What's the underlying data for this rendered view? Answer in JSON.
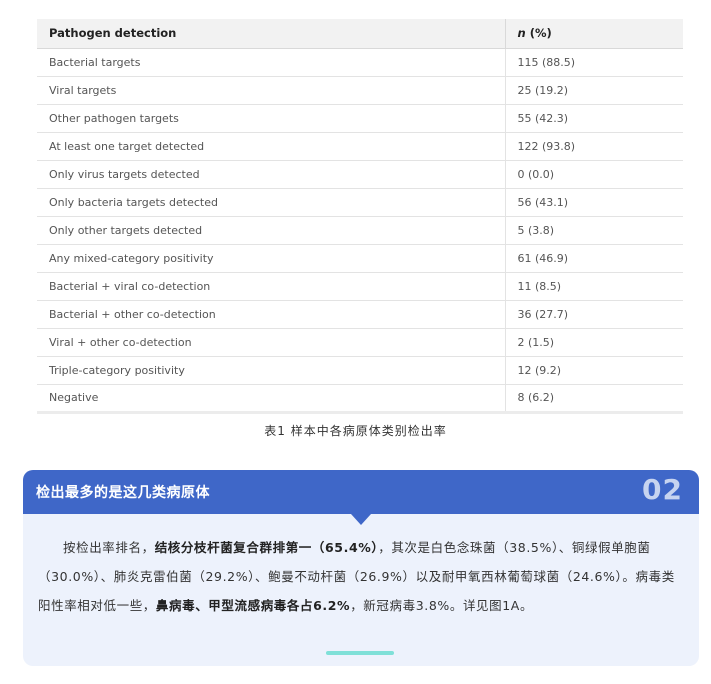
{
  "table": {
    "headers": [
      "Pathogen detection",
      "n",
      "(%)"
    ],
    "rows": [
      [
        "Bacterial targets",
        "115 (88.5)"
      ],
      [
        "Viral targets",
        "25 (19.2)"
      ],
      [
        "Other pathogen targets",
        "55 (42.3)"
      ],
      [
        "At least one target detected",
        "122 (93.8)"
      ],
      [
        "Only virus targets detected",
        "0 (0.0)"
      ],
      [
        "Only bacteria targets detected",
        "56 (43.1)"
      ],
      [
        "Only other targets detected",
        "5 (3.8)"
      ],
      [
        "Any mixed-category positivity",
        "61 (46.9)"
      ],
      [
        "Bacterial + viral co-detection",
        "11 (8.5)"
      ],
      [
        "Bacterial + other co-detection",
        "36 (27.7)"
      ],
      [
        "Viral + other co-detection",
        "2 (1.5)"
      ],
      [
        "Triple-category positivity",
        "12 (9.2)"
      ],
      [
        "Negative",
        "8 (6.2)"
      ]
    ],
    "caption": "表1  样本中各病原体类别检出率"
  },
  "section": {
    "title": "检出最多的是这几类病原体",
    "number": "02",
    "p1": "按检出率排名，",
    "p2": "结核分枝杆菌复合群排第一（65.4%）",
    "p3": "，其次是白色念珠菌（38.5%）、铜绿假单胞菌（30.0%）、肺炎克雷伯菌（29.2%）、鲍曼不动杆菌（26.9%）以及耐甲氧西林葡萄球菌（24.6%）。病毒类阳性率相对低一些，",
    "p4": "鼻病毒、甲型流感病毒各占6.2%",
    "p5": "，新冠病毒3.8%。详见图1A。"
  },
  "colors": {
    "header_blue": "#3f67c8",
    "card_bg": "#edf2fc",
    "accent_teal": "#7fe0d8"
  }
}
